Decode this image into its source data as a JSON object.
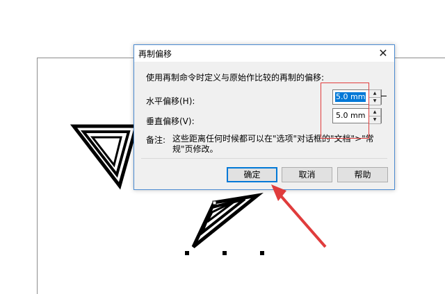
{
  "dialog": {
    "title": "再制偏移",
    "close_glyph": "✕",
    "description": "使用再制命令时定义与原始作比较的再制的偏移:",
    "horizontal_label": "水平偏移(H):",
    "horizontal_value": "5.0 mm",
    "vertical_label": "垂直偏移(V):",
    "vertical_value": "5.0 mm",
    "note_label": "备注:",
    "note_text": "这些距离任何时候都可以在\"选项\"对话框的\"文档\">\"常规\"页修改。",
    "buttons": {
      "ok": "确定",
      "cancel": "取消",
      "help": "帮助"
    }
  },
  "icons": {
    "close": "close-icon",
    "spin_up": "spin-up-icon",
    "spin_down": "spin-down-icon"
  },
  "colors": {
    "dialog_border": "#4a8ad1",
    "selection": "#0078d7",
    "annotation": "#e03c3c"
  }
}
